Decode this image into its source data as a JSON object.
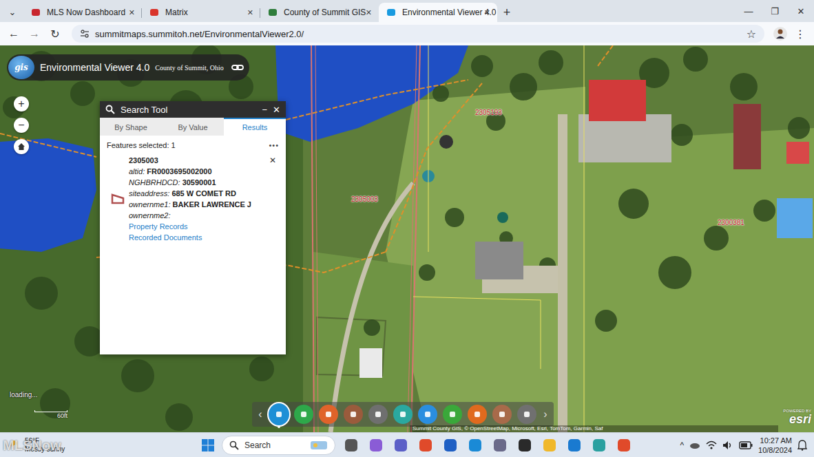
{
  "browser": {
    "tab_menu": "⌄",
    "tabs": [
      {
        "label": "MLS Now Dashboard",
        "selected": false
      },
      {
        "label": "Matrix",
        "selected": false
      },
      {
        "label": "County of Summit GIS",
        "selected": false
      },
      {
        "label": "Environmental Viewer 4.0",
        "selected": true
      }
    ],
    "tab_close": "✕",
    "new_tab": "+",
    "window_controls": [
      "—",
      "❐",
      "✕"
    ],
    "nav": [
      "←",
      "→",
      "↻"
    ],
    "url": "summitmaps.summitoh.net/EnvironmentalViewer2.0/",
    "star": "☆",
    "menu": "⋮"
  },
  "app": {
    "logo": "gis",
    "title": "Environmental Viewer 4.0",
    "subtitle": "County of Summit, Ohio"
  },
  "zoom": {
    "in": "+",
    "out": "−"
  },
  "search_tool": {
    "title": "Search Tool",
    "minimize": "−",
    "close": "✕",
    "tabs": [
      {
        "label": "By Shape",
        "selected": false
      },
      {
        "label": "By Value",
        "selected": false
      },
      {
        "label": "Results",
        "selected": true
      }
    ],
    "features_selected": "Features selected: 1",
    "more": "•••",
    "result": {
      "id": "2305003",
      "close": "✕",
      "fields": [
        {
          "label": "altid:",
          "value": "FR0003695002000"
        },
        {
          "label": "NGHBRHDCD:",
          "value": "30590001"
        },
        {
          "label": "siteaddress:",
          "value": "685 W COMET RD"
        },
        {
          "label": "ownernme1:",
          "value": "BAKER LAWRENCE J"
        },
        {
          "label": "ownernme2:"
        }
      ],
      "links": [
        "Property Records",
        "Recorded Documents"
      ]
    }
  },
  "map": {
    "parcel_labels": [
      "2305193",
      "2305003",
      "2300381"
    ],
    "loading": "loading...",
    "scale": "60ft"
  },
  "toolbar": {
    "prev": "‹",
    "next": "›",
    "tools": [
      {
        "color": "#1e8fd6",
        "selected": true
      },
      {
        "color": "#2ea84a",
        "selected": false
      },
      {
        "color": "#e0632a",
        "selected": false
      },
      {
        "color": "#9a5b3c",
        "selected": false
      },
      {
        "color": "#6f6f6f",
        "selected": false
      },
      {
        "color": "#2aa8a0",
        "selected": false
      },
      {
        "color": "#2a8ee0",
        "selected": false
      },
      {
        "color": "#3aa83a",
        "selected": false
      },
      {
        "color": "#e06a1e",
        "selected": false
      },
      {
        "color": "#a86a4a",
        "selected": false
      },
      {
        "color": "#707070",
        "selected": false
      }
    ]
  },
  "attribution": "Summit County GIS, © OpenStreetMap, Microsoft, Esri, TomTom, Garmin, Saf",
  "esri": {
    "powered": "POWERED BY",
    "brand": "esri"
  },
  "taskbar": {
    "weather": {
      "temp": "56°F",
      "desc": "Mostly sunny"
    },
    "search": "Search",
    "tray_expand": "^",
    "time": "10:27 AM",
    "date": "10/8/2024"
  },
  "watermark": "MLSNow"
}
